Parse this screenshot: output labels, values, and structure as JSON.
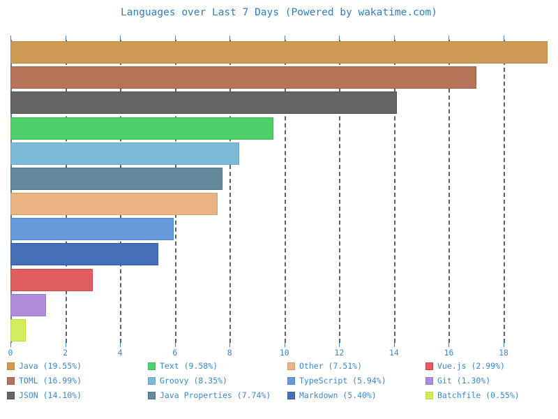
{
  "chart_data": {
    "type": "bar",
    "orientation": "horizontal",
    "title": "Languages over Last 7 Days (Powered by wakatime.com)",
    "xlabel": "",
    "ylabel": "",
    "xlim": [
      0,
      19.6
    ],
    "xticks": [
      0,
      2,
      4,
      6,
      8,
      10,
      12,
      14,
      16,
      18
    ],
    "xticklabels": [
      "0",
      "2",
      "4",
      "6",
      "8",
      "10",
      "12",
      "14",
      "16",
      "18"
    ],
    "grid": true,
    "grid_axis": "x",
    "legend_position": "bottom",
    "legend_columns": 4,
    "categories": [
      "Java",
      "TOML",
      "JSON",
      "Text",
      "Groovy",
      "Java Properties",
      "Other",
      "TypeScript",
      "Markdown",
      "Vue.js",
      "Git",
      "Batchfile"
    ],
    "values": [
      19.6,
      17.0,
      14.1,
      9.6,
      8.35,
      7.75,
      7.55,
      5.95,
      5.4,
      3.0,
      1.3,
      0.55
    ],
    "percents": [
      "19.55%",
      "16.99%",
      "14.10%",
      "9.58%",
      "8.35%",
      "7.74%",
      "7.51%",
      "5.94%",
      "5.40%",
      "2.99%",
      "1.30%",
      "0.55%"
    ],
    "colors": [
      "#CE9A55",
      "#B5735A",
      "#656565",
      "#4FD16A",
      "#7DBAD7",
      "#628A9B",
      "#E9B384",
      "#6699DA",
      "#4570B8",
      "#E25D5D",
      "#B18BDB",
      "#D2ED5B"
    ],
    "edge_colors": [
      "#B98645",
      "#9F5F48",
      "#505050",
      "#3BBD57",
      "#68A6C4",
      "#4E7688",
      "#D69E6E",
      "#5285C7",
      "#305CA4",
      "#CD4747",
      "#9C76C7",
      "#BDD946"
    ],
    "series": [
      {
        "name": "Java",
        "value": 19.6,
        "percent": "19.55%",
        "label": "Java (19.55%)",
        "color": "#CE9A55"
      },
      {
        "name": "TOML",
        "value": 17.0,
        "percent": "16.99%",
        "label": "TOML (16.99%)",
        "color": "#B5735A"
      },
      {
        "name": "JSON",
        "value": 14.1,
        "percent": "14.10%",
        "label": "JSON (14.10%)",
        "color": "#656565"
      },
      {
        "name": "Text",
        "value": 9.6,
        "percent": "9.58%",
        "label": "Text (9.58%)",
        "color": "#4FD16A"
      },
      {
        "name": "Groovy",
        "value": 8.35,
        "percent": "8.35%",
        "label": "Groovy (8.35%)",
        "color": "#7DBAD7"
      },
      {
        "name": "Java Properties",
        "value": 7.75,
        "percent": "7.74%",
        "label": "Java Properties (7.74%)",
        "color": "#628A9B"
      },
      {
        "name": "Other",
        "value": 7.55,
        "percent": "7.51%",
        "label": "Other (7.51%)",
        "color": "#E9B384"
      },
      {
        "name": "TypeScript",
        "value": 5.95,
        "percent": "5.94%",
        "label": "TypeScript (5.94%)",
        "color": "#6699DA"
      },
      {
        "name": "Markdown",
        "value": 5.4,
        "percent": "5.40%",
        "label": "Markdown (5.40%)",
        "color": "#4570B8"
      },
      {
        "name": "Vue.js",
        "value": 3.0,
        "percent": "2.99%",
        "label": "Vue.js (2.99%)",
        "color": "#E25D5D"
      },
      {
        "name": "Git",
        "value": 1.3,
        "percent": "1.30%",
        "label": "Git (1.30%)",
        "color": "#B18BDB"
      },
      {
        "name": "Batchfile",
        "value": 0.55,
        "percent": "0.55%",
        "label": "Batchfile (0.55%)",
        "color": "#D2ED5B"
      }
    ]
  },
  "style": {
    "text_color": "#3C87C8",
    "title_color": "#2E7EBB",
    "axis_color": "#3C87C8",
    "grid_color": "#545454",
    "background": "#FFFFFF"
  },
  "legend": {
    "entries": [
      "Java (19.55%)",
      "Groovy (8.35%)",
      "Markdown (5.40%)",
      "TOML (16.99%)",
      "Java Properties (7.74%)",
      "Vue.js (2.99%)",
      "JSON (14.10%)",
      "Other (7.51%)",
      "Git (1.30%)",
      "Text (9.58%)",
      "TypeScript (5.94%)",
      "Batchfile (0.55%)"
    ]
  }
}
